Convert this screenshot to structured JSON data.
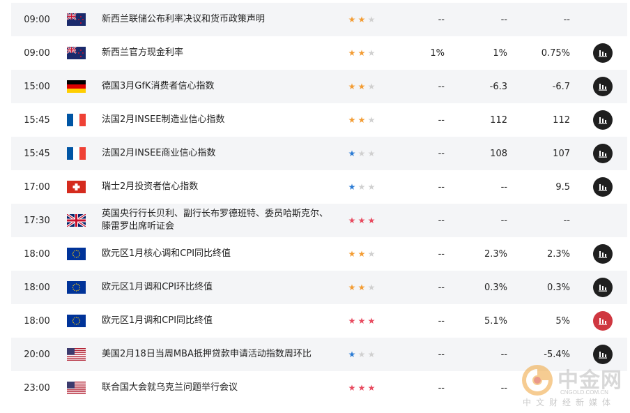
{
  "colors": {
    "star_orange": "#f39c33",
    "star_red": "#e84a5f",
    "star_blue": "#2b7bd4",
    "star_off": "#d0d0d0"
  },
  "rows": [
    {
      "time": "09:00",
      "flag": "nz",
      "event": "新西兰联储公布利率决议和货币政策声明",
      "stars": 2,
      "star_color": "orange",
      "previous": "--",
      "forecast": "--",
      "actual": "--",
      "chart": false
    },
    {
      "time": "09:00",
      "flag": "nz",
      "event": "新西兰官方现金利率",
      "stars": 2,
      "star_color": "orange",
      "previous": "1%",
      "forecast": "1%",
      "actual": "0.75%",
      "chart": true
    },
    {
      "time": "15:00",
      "flag": "de",
      "event": "德国3月GfK消费者信心指数",
      "stars": 2,
      "star_color": "orange",
      "previous": "--",
      "forecast": "-6.3",
      "actual": "-6.7",
      "chart": true
    },
    {
      "time": "15:45",
      "flag": "fr",
      "event": "法国2月INSEE制造业信心指数",
      "stars": 2,
      "star_color": "orange",
      "previous": "--",
      "forecast": "112",
      "actual": "112",
      "chart": true
    },
    {
      "time": "15:45",
      "flag": "fr",
      "event": "法国2月INSEE商业信心指数",
      "stars": 1,
      "star_color": "blue",
      "previous": "--",
      "forecast": "108",
      "actual": "107",
      "chart": true
    },
    {
      "time": "17:00",
      "flag": "ch",
      "event": "瑞士2月投资者信心指数",
      "stars": 1,
      "star_color": "blue",
      "previous": "--",
      "forecast": "--",
      "actual": "9.5",
      "chart": true
    },
    {
      "time": "17:30",
      "flag": "uk",
      "event": "英国央行行长贝利、副行长布罗德班特、委员哈斯克尔、滕雷罗出席听证会",
      "stars": 3,
      "star_color": "red",
      "previous": "--",
      "forecast": "--",
      "actual": "--",
      "chart": false
    },
    {
      "time": "18:00",
      "flag": "eu",
      "event": "欧元区1月核心调和CPI同比终值",
      "stars": 2,
      "star_color": "orange",
      "previous": "--",
      "forecast": "2.3%",
      "actual": "2.3%",
      "chart": true
    },
    {
      "time": "18:00",
      "flag": "eu",
      "event": "欧元区1月调和CPI环比终值",
      "stars": 2,
      "star_color": "orange",
      "previous": "--",
      "forecast": "0.3%",
      "actual": "0.3%",
      "chart": true
    },
    {
      "time": "18:00",
      "flag": "eu",
      "event": "欧元区1月调和CPI同比终值",
      "stars": 3,
      "star_color": "red",
      "previous": "--",
      "forecast": "5.1%",
      "actual": "5%",
      "chart": true,
      "chart_red": true
    },
    {
      "time": "20:00",
      "flag": "us",
      "event": "美国2月18日当周MBA抵押贷款申请活动指数周环比",
      "stars": 1,
      "star_color": "blue",
      "previous": "--",
      "forecast": "--",
      "actual": "-5.4%",
      "chart": true
    },
    {
      "time": "23:00",
      "flag": "us",
      "event": "联合国大会就乌克兰问题举行会议",
      "stars": 3,
      "star_color": "red",
      "previous": "--",
      "forecast": "--",
      "actual": "",
      "chart": false
    }
  ],
  "watermark": {
    "name": "中金网",
    "url": "CNGOLD.COM.CN",
    "tagline": "中文财经新媒体"
  }
}
